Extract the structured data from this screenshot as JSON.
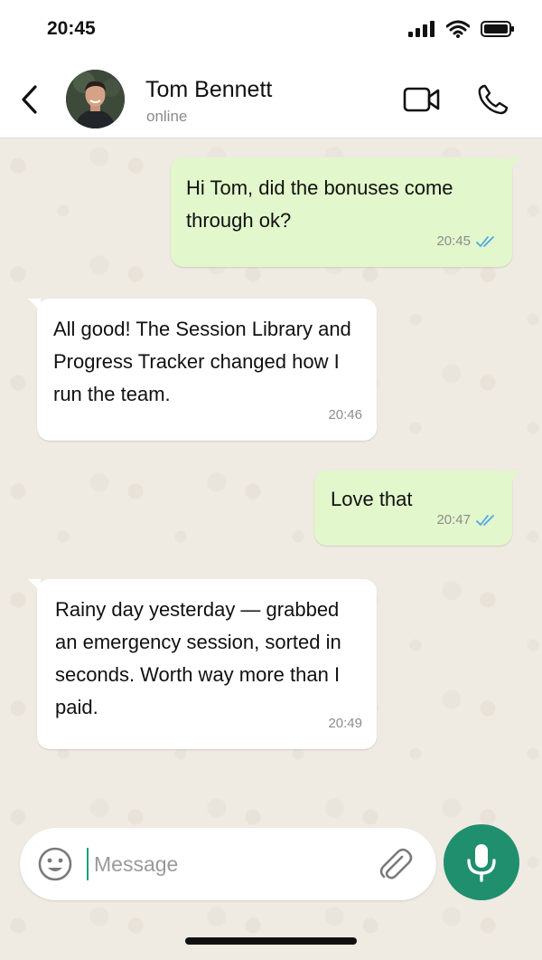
{
  "status_bar": {
    "time": "20:45"
  },
  "header": {
    "contact_name": "Tom Bennett",
    "contact_status": "online"
  },
  "messages": [
    {
      "direction": "out",
      "text": "Hi Tom, did the bonuses come through ok?",
      "time": "20:45",
      "read": true
    },
    {
      "direction": "in",
      "text": "All good! The Session Library and Progress Tracker changed how I run the team.",
      "time": "20:46"
    },
    {
      "direction": "out",
      "text": "Love that",
      "time": "20:47",
      "read": true
    },
    {
      "direction": "in",
      "text": "Rainy day yesterday — grabbed an emergency session, sorted in seconds. Worth way more than I paid.",
      "time": "20:49"
    }
  ],
  "composer": {
    "placeholder": "Message",
    "value": ""
  },
  "colors": {
    "outgoing_bubble": "#e2f7cb",
    "incoming_bubble": "#ffffff",
    "accent": "#1f8f6e",
    "read_ticks": "#4fa6e8",
    "chat_background": "#efeae2"
  },
  "icons": [
    "back-arrow-icon",
    "video-call-icon",
    "phone-icon",
    "double-check-icon",
    "emoji-icon",
    "paperclip-icon",
    "microphone-icon"
  ]
}
